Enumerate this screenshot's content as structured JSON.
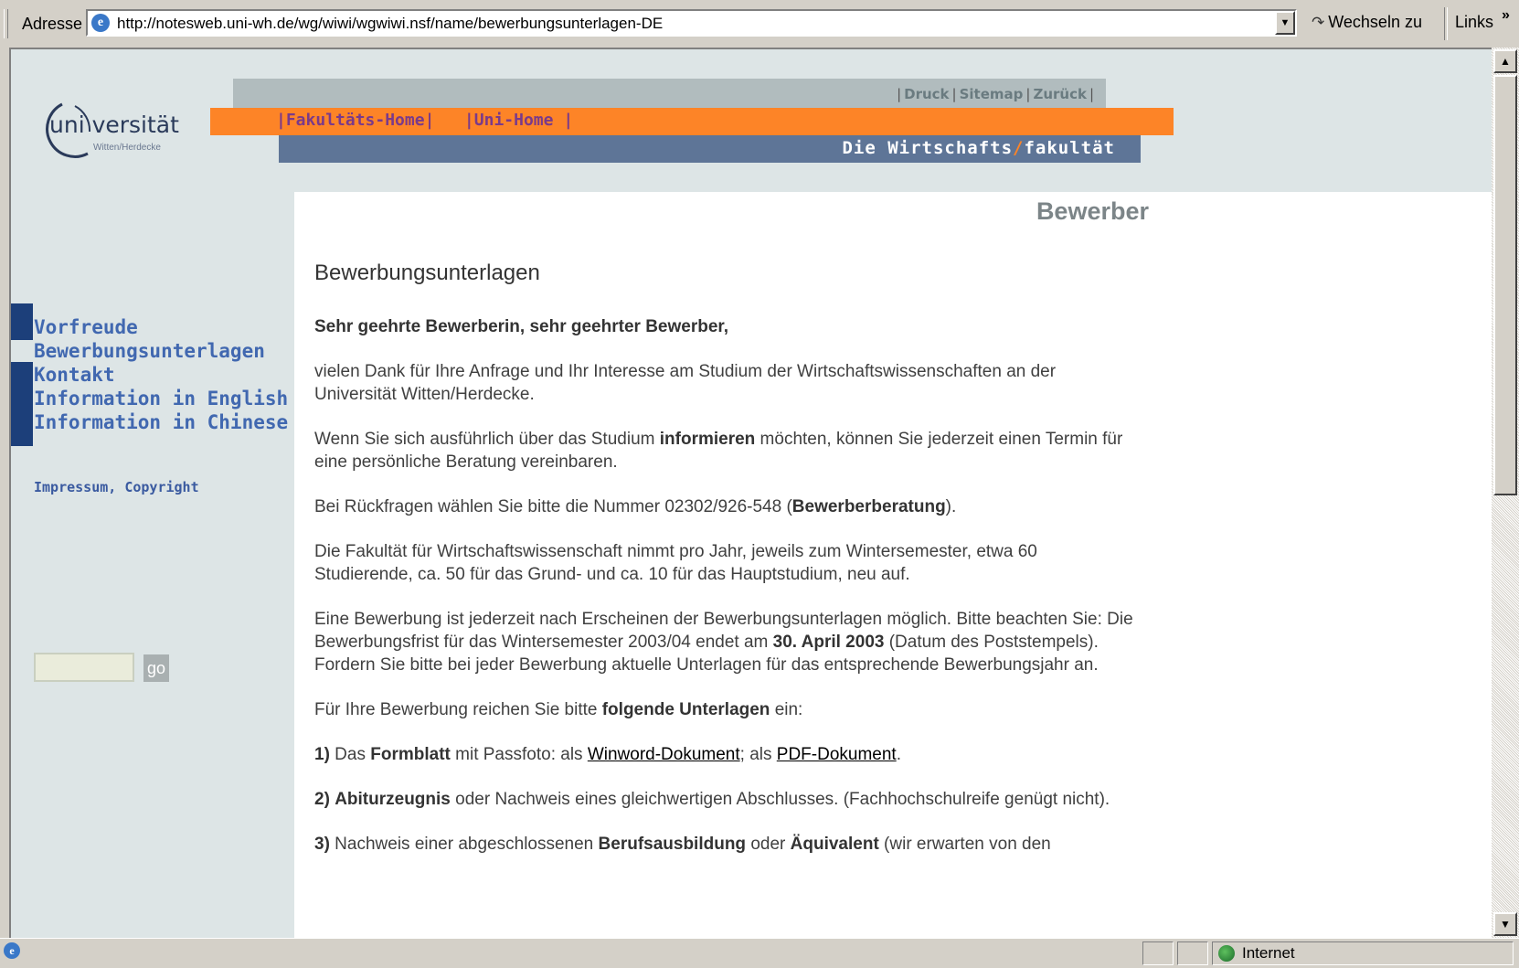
{
  "browser": {
    "address_label": "Adresse",
    "url": "http://notesweb.uni-wh.de/wg/wiwi/wgwiwi.nsf/name/bewerbungsunterlagen-DE",
    "goto_label": "Wechseln zu",
    "links_label": "Links",
    "links_chevron": "»",
    "status_zone": "Internet"
  },
  "header": {
    "logo_text": "uni versität",
    "logo_sub": "Witten/Herdecke",
    "top_links": [
      "Druck",
      "Sitemap",
      "Zurück"
    ],
    "orange_links": [
      "Fakultäts-Home",
      "Uni-Home"
    ],
    "faculty_title_part1": "Die Wirtschafts",
    "faculty_title_part2": "fakultät"
  },
  "sidebar": {
    "nav_items": [
      "Vorfreude",
      "Bewerbungsunterlagen",
      "Kontakt",
      "Information in English",
      "Information in Chinese"
    ],
    "impressum": "Impressum, Copyright",
    "search_value": "",
    "go_label": "go"
  },
  "content": {
    "section_title": "Bewerber",
    "heading": "Bewerbungsunterlagen",
    "greeting": "Sehr geehrte Bewerberin, sehr geehrter Bewerber,",
    "p1": "vielen Dank für Ihre Anfrage und Ihr Interesse am Studium der Wirtschaftswissenschaften an der Universität Witten/Herdecke.",
    "p2_a": "Wenn Sie sich ausführlich über das Studium ",
    "p2_b": "informieren",
    "p2_c": " möchten, können Sie jederzeit einen Termin für eine persönliche Beratung vereinbaren.",
    "p3_a": "Bei Rückfragen wählen Sie bitte die Nummer 02302/926-548 (",
    "p3_b": "Bewerberberatung",
    "p3_c": ").",
    "p4": "Die Fakultät für Wirtschaftswissenschaft nimmt pro Jahr, jeweils zum Wintersemester, etwa 60 Studierende, ca. 50 für das Grund- und ca. 10 für das Hauptstudium, neu auf.",
    "p5_a": "Eine Bewerbung ist jederzeit nach Erscheinen der Bewerbungsunterlagen möglich. Bitte beachten Sie: Die Bewerbungsfrist für das Wintersemester 2003/04 endet am ",
    "p5_b": "30. April 2003",
    "p5_c": " (Datum des Poststempels). Fordern Sie bitte bei jeder Bewerbung aktuelle Unterlagen für das entsprechende Bewerbungsjahr an.",
    "p6_a": "Für Ihre Bewerbung reichen Sie bitte ",
    "p6_b": "folgende Unterlagen",
    "p6_c": " ein:",
    "item1_num": "1)",
    "item1_a": " Das ",
    "item1_b": "Formblatt",
    "item1_c": " mit Passfoto: als ",
    "item1_link1": "Winword-Dokument",
    "item1_d": "; als ",
    "item1_link2": "PDF-Dokument",
    "item1_e": ".",
    "item2_num": "2)",
    "item2_b": "Abiturzeugnis",
    "item2_c": " oder Nachweis eines gleichwertigen Abschlusses. (Fachhochschulreife genügt nicht).",
    "item3_num": "3)",
    "item3_a": " Nachweis einer abgeschlossenen ",
    "item3_b": "Berufsausbildung",
    "item3_c": " oder ",
    "item3_d": "Äquivalent",
    "item3_e": " (wir erwarten von den"
  },
  "colors": {
    "orange": "#fd8427",
    "navy_bar": "#5e7597",
    "nav_link": "#4168b0",
    "nav_marker": "#1c3f7a"
  }
}
